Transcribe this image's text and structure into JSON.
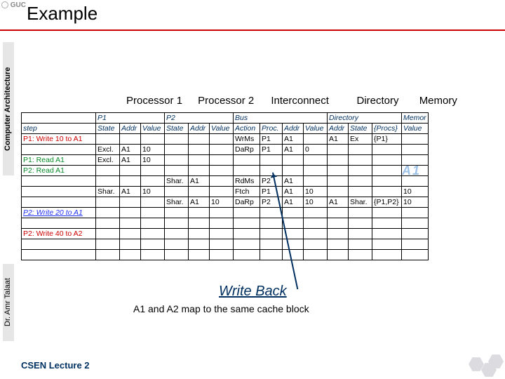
{
  "header": {
    "logo_text": "GUC",
    "title": "Example"
  },
  "sidebar": "Computer Architecture",
  "author": "Dr. Amr Talaat",
  "footer": "CSEN Lecture 2",
  "section_labels": {
    "p1": "Processor 1",
    "p2": "Processor 2",
    "ic": "Interconnect",
    "dir": "Directory",
    "mem": "Memory"
  },
  "table": {
    "headers": {
      "step": "step",
      "p1": "P1",
      "p2": "P2",
      "bus": "Bus",
      "dir": "Directory",
      "mem": "Memor",
      "state": "State",
      "addr": "Addr",
      "value": "Value",
      "action": "Action",
      "proc": "Proc.",
      "procs": "{Procs}"
    },
    "rows": [
      {
        "step": "P1: Write 10 to A1",
        "cls": "red",
        "p1": [
          "",
          "",
          ""
        ],
        "p2": [
          "",
          "",
          ""
        ],
        "bus": [
          "WrMs",
          "P1",
          "A1",
          ""
        ],
        "dir": [
          "A1",
          "Ex",
          "{P1}"
        ],
        "mem": ""
      },
      {
        "step": "",
        "cls": "",
        "p1": [
          "Excl.",
          "A1",
          "10"
        ],
        "p2": [
          "",
          "",
          ""
        ],
        "bus": [
          "DaRp",
          "P1",
          "A1",
          "0"
        ],
        "dir": [
          "",
          "",
          ""
        ],
        "mem": ""
      },
      {
        "step": "P1: Read A1",
        "cls": "green",
        "p1": [
          "Excl.",
          "A1",
          "10"
        ],
        "p2": [
          "",
          "",
          ""
        ],
        "bus": [
          "",
          "",
          "",
          ""
        ],
        "dir": [
          "",
          "",
          ""
        ],
        "mem": ""
      },
      {
        "step": "P2: Read A1",
        "cls": "green",
        "p1": [
          "",
          "",
          ""
        ],
        "p2": [
          "",
          "",
          ""
        ],
        "bus": [
          "",
          "",
          "",
          ""
        ],
        "dir": [
          "",
          "",
          ""
        ],
        "mem": ""
      },
      {
        "step": "",
        "cls": "",
        "p1": [
          "",
          "",
          ""
        ],
        "p2": [
          "Shar.",
          "A1",
          ""
        ],
        "bus": [
          "RdMs",
          "P2",
          "A1",
          ""
        ],
        "dir": [
          "",
          "",
          ""
        ],
        "mem": ""
      },
      {
        "step": "",
        "cls": "",
        "p1": [
          "Shar.",
          "A1",
          "10"
        ],
        "p2": [
          "",
          "",
          ""
        ],
        "bus": [
          "Ftch",
          "P1",
          "A1",
          "10"
        ],
        "dir": [
          "",
          "",
          ""
        ],
        "mem": "10"
      },
      {
        "step": "",
        "cls": "",
        "p1": [
          "",
          "",
          ""
        ],
        "p2": [
          "Shar.",
          "A1",
          "10"
        ],
        "bus": [
          "DaRp",
          "P2",
          "A1",
          "10"
        ],
        "dir": [
          "A1",
          "Shar.",
          "{P1,P2}"
        ],
        "mem": "10"
      },
      {
        "step": "P2: Write 20 to A1",
        "cls": "blue",
        "p1": [
          "",
          "",
          ""
        ],
        "p2": [
          "",
          "",
          ""
        ],
        "bus": [
          "",
          "",
          "",
          ""
        ],
        "dir": [
          "",
          "",
          ""
        ],
        "mem": ""
      },
      {
        "step": "",
        "cls": "",
        "p1": [
          "",
          "",
          ""
        ],
        "p2": [
          "",
          "",
          ""
        ],
        "bus": [
          "",
          "",
          "",
          ""
        ],
        "dir": [
          "",
          "",
          ""
        ],
        "mem": ""
      },
      {
        "step": "P2: Write 40 to A2",
        "cls": "red",
        "p1": [
          "",
          "",
          ""
        ],
        "p2": [
          "",
          "",
          ""
        ],
        "bus": [
          "",
          "",
          "",
          ""
        ],
        "dir": [
          "",
          "",
          ""
        ],
        "mem": ""
      },
      {
        "step": "",
        "cls": "",
        "p1": [
          "",
          "",
          ""
        ],
        "p2": [
          "",
          "",
          ""
        ],
        "bus": [
          "",
          "",
          "",
          ""
        ],
        "dir": [
          "",
          "",
          ""
        ],
        "mem": ""
      },
      {
        "step": "",
        "cls": "",
        "p1": [
          "",
          "",
          ""
        ],
        "p2": [
          "",
          "",
          ""
        ],
        "bus": [
          "",
          "",
          "",
          ""
        ],
        "dir": [
          "",
          "",
          ""
        ],
        "mem": ""
      }
    ]
  },
  "annotation": "A1",
  "writeback": {
    "title": "Write Back",
    "note": "A1 and A2 map to the same cache block"
  }
}
